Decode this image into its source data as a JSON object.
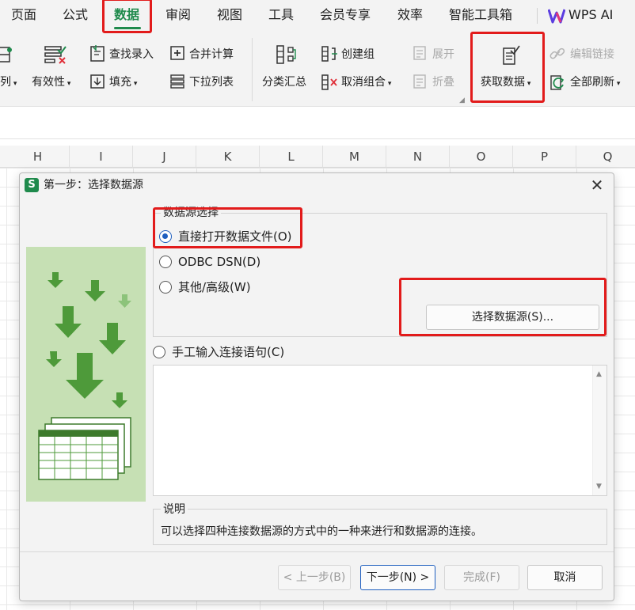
{
  "menu": {
    "items": [
      "页面",
      "公式",
      "数据",
      "审阅",
      "视图",
      "工具",
      "会员专享",
      "效率",
      "智能工具箱"
    ],
    "active": "数据",
    "wps_ai": "WPS AI"
  },
  "ribbon": {
    "partial_left_label": "列",
    "validity_label": "有效性",
    "find_entry_label": "查找录入",
    "fill_label": "填充",
    "consolidate_label": "合并计算",
    "dropdown_list_label": "下拉列表",
    "subtotal_label": "分类汇总",
    "create_group_label": "创建组",
    "ungroup_label": "取消组合",
    "expand_label": "展开",
    "collapse_label": "折叠",
    "get_data_label": "获取数据",
    "edit_links_label": "编辑链接",
    "refresh_all_label": "全部刷新"
  },
  "sheet": {
    "columns": [
      "H",
      "I",
      "J",
      "K",
      "L",
      "M",
      "N",
      "O",
      "P",
      "Q"
    ]
  },
  "dialog": {
    "title": "第一步：选择数据源",
    "group_legend": "数据源选择",
    "options": {
      "open_file": "直接打开数据文件(O)",
      "odbc": "ODBC DSN(D)",
      "other": "其他/高级(W)",
      "manual": "手工输入连接语句(C)"
    },
    "selected_option": "open_file",
    "select_source_button": "选择数据源(S)...",
    "description_legend": "说明",
    "description_text": "可以选择四种连接数据源的方式中的一种来进行和数据源的连接。",
    "buttons": {
      "back": "< 上一步(B)",
      "next": "下一步(N) >",
      "finish": "完成(F)",
      "cancel": "取消"
    }
  },
  "colors": {
    "accent_green": "#1f8a4c",
    "highlight_red": "#e21b1b",
    "panel_green": "#c6e0b4",
    "arrow_green": "#4e9a3a",
    "radio_blue": "#1f5fbf"
  },
  "icons": [
    "wps-ai-logo-icon",
    "validity-icon",
    "find-entry-icon",
    "fill-icon",
    "consolidate-icon",
    "dropdown-list-icon",
    "subtotal-icon",
    "create-group-icon",
    "ungroup-icon",
    "expand-icon",
    "collapse-icon",
    "get-data-icon",
    "edit-links-icon",
    "refresh-all-icon",
    "close-icon",
    "data-import-illustration-icon"
  ]
}
